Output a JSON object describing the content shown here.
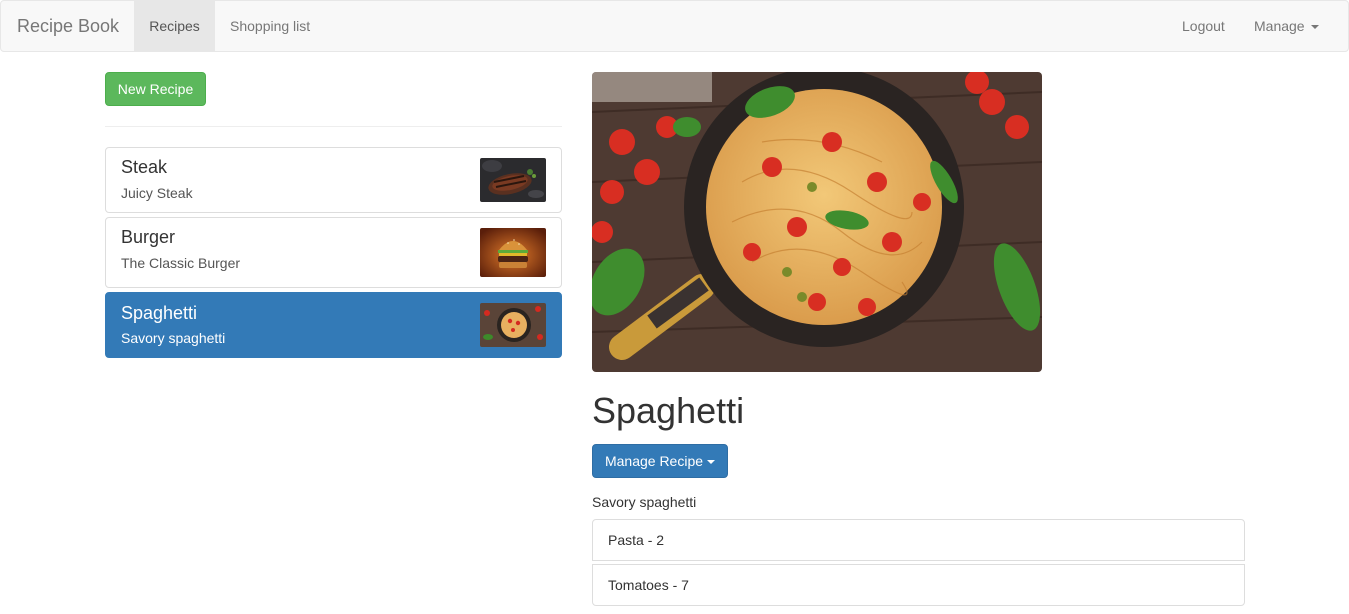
{
  "navbar": {
    "brand": "Recipe Book",
    "links": [
      "Recipes",
      "Shopping list"
    ],
    "logout": "Logout",
    "manage": "Manage"
  },
  "sidebar": {
    "new_recipe": "New Recipe",
    "recipes": [
      {
        "name": "Steak",
        "description": "Juicy Steak"
      },
      {
        "name": "Burger",
        "description": "The Classic Burger"
      },
      {
        "name": "Spaghetti",
        "description": "Savory spaghetti"
      }
    ]
  },
  "detail": {
    "title": "Spaghetti",
    "manage_button": "Manage Recipe",
    "description": "Savory spaghetti",
    "ingredients": [
      "Pasta - 2",
      "Tomatoes - 7"
    ]
  },
  "colors": {
    "primary": "#337ab7",
    "success": "#5cb85c",
    "navbar_bg": "#f8f8f8"
  }
}
